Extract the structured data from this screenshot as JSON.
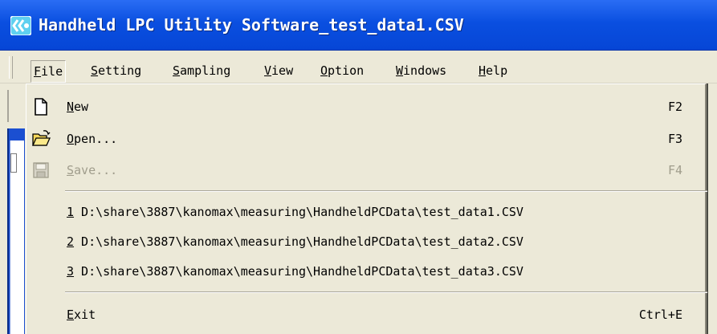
{
  "window": {
    "title": "Handheld LPC Utility Software_test_data1.CSV",
    "icon": "app-logo-icon"
  },
  "menubar": {
    "items": [
      {
        "label": "File",
        "key": "F",
        "rest": "ile"
      },
      {
        "label": "Setting",
        "key": "S",
        "rest": "etting"
      },
      {
        "label": "Sampling",
        "key": "S",
        "rest": "ampling"
      },
      {
        "label": "View",
        "key": "V",
        "rest": "iew"
      },
      {
        "label": "Option",
        "key": "O",
        "rest": "ption"
      },
      {
        "label": "Windows",
        "key": "W",
        "rest": "indows"
      },
      {
        "label": "Help",
        "key": "H",
        "rest": "elp"
      }
    ]
  },
  "file_menu": {
    "new": {
      "key": "N",
      "rest": "ew",
      "shortcut": "F2",
      "icon": "new-document-icon"
    },
    "open": {
      "key": "O",
      "rest": "pen...",
      "shortcut": "F3",
      "icon": "open-folder-icon"
    },
    "save": {
      "key": "S",
      "rest": "ave...",
      "shortcut": "F4",
      "icon": "save-disk-icon",
      "disabled": true
    },
    "recent": [
      {
        "num": "1",
        "path": " D:\\share\\3887\\kanomax\\measuring\\HandheldPCData\\test_data1.CSV"
      },
      {
        "num": "2",
        "path": " D:\\share\\3887\\kanomax\\measuring\\HandheldPCData\\test_data2.CSV"
      },
      {
        "num": "3",
        "path": " D:\\share\\3887\\kanomax\\measuring\\HandheldPCData\\test_data3.CSV"
      }
    ],
    "exit": {
      "key": "E",
      "rest": "xit",
      "shortcut": "Ctrl+E"
    }
  },
  "colors": {
    "titlebar": "#0a4fe0",
    "menu_bg": "#ece9d8",
    "disabled_text": "#a09d8c"
  }
}
